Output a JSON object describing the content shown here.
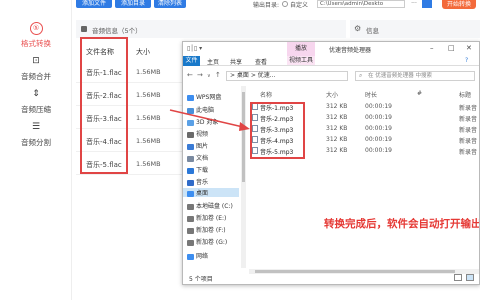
{
  "sidebar": {
    "items": [
      {
        "label": "格式转换",
        "icon": "convert-icon",
        "glyph": "⑤",
        "active": true
      },
      {
        "label": "音频合并",
        "icon": "merge-icon",
        "glyph": "⊡"
      },
      {
        "label": "音频压缩",
        "icon": "compress-icon",
        "glyph": "⇕"
      },
      {
        "label": "音频分割",
        "icon": "split-icon",
        "glyph": "☰"
      }
    ]
  },
  "toolbar": {
    "add_file": "添加文件",
    "add_folder": "添加目录",
    "clear_list": "清除列表",
    "output_dir_label": "输出目录:",
    "output_dir_option": "自定义",
    "output_path": "C:\\Users\\admin\\Deskto",
    "browse": "···",
    "start": "开始转换"
  },
  "list": {
    "header": "音频信息（5个）",
    "col_name": "文件名称",
    "col_size": "大小",
    "rows": [
      {
        "name": "音乐-1.flac",
        "size": "1.56MB"
      },
      {
        "name": "音乐-2.flac",
        "size": "1.56MB"
      },
      {
        "name": "音乐-3.flac",
        "size": "1.56MB"
      },
      {
        "name": "音乐-4.flac",
        "size": "1.56MB"
      },
      {
        "name": "音乐-5.flac",
        "size": "1.56MB"
      }
    ]
  },
  "info": {
    "header": "信息"
  },
  "explorer": {
    "manage_tab": "播放",
    "window_title": "优速音频处理器",
    "ribbon": {
      "file": "文件",
      "home": "主页",
      "share": "共享",
      "view": "查看",
      "tools": "视频工具"
    },
    "address": "> 桌面 > 优速...",
    "search_placeholder": "在 优速音频处理器 中搜索",
    "nav_items": [
      {
        "label": "WPS网盘",
        "color": "#3d8ef0"
      },
      {
        "label": "此电脑",
        "color": "#4a90d9"
      },
      {
        "label": "3D 对象",
        "color": "#5aa0e6"
      },
      {
        "label": "视频",
        "color": "#6a6a6a"
      },
      {
        "label": "图片",
        "color": "#3a7bd5"
      },
      {
        "label": "文档",
        "color": "#7a8aa0"
      },
      {
        "label": "下载",
        "color": "#2b78d8"
      },
      {
        "label": "音乐",
        "color": "#2f6bc9"
      },
      {
        "label": "桌面",
        "color": "#3d8ef0",
        "selected": true
      },
      {
        "label": "本地磁盘 (C:)",
        "color": "#777"
      },
      {
        "label": "新加卷 (E:)",
        "color": "#777"
      },
      {
        "label": "新加卷 (F:)",
        "color": "#777"
      },
      {
        "label": "新加卷 (G:)",
        "color": "#777"
      },
      {
        "label": "网络",
        "color": "#3d8ef0"
      }
    ],
    "columns": {
      "name": "名称",
      "size": "大小",
      "duration": "时长",
      "num": "#",
      "title": "标题"
    },
    "files": [
      {
        "name": "音乐-1.mp3",
        "size": "312 KB",
        "duration": "00:00:19",
        "title": "新录音"
      },
      {
        "name": "音乐-2.mp3",
        "size": "312 KB",
        "duration": "00:00:19",
        "title": "新录音"
      },
      {
        "name": "音乐-3.mp3",
        "size": "312 KB",
        "duration": "00:00:19",
        "title": "新录音"
      },
      {
        "name": "音乐-4.mp3",
        "size": "312 KB",
        "duration": "00:00:19",
        "title": "新录音"
      },
      {
        "name": "音乐-5.mp3",
        "size": "312 KB",
        "duration": "00:00:19",
        "title": "新录音"
      }
    ],
    "status": "5 个项目"
  },
  "annotation": "转换完成后，软件会自动打开输出文件夹",
  "colors": {
    "accent_blue": "#2f7be4",
    "start_orange": "#f36a3b",
    "highlight_red": "#e04545",
    "active_red": "#e94f4f"
  }
}
